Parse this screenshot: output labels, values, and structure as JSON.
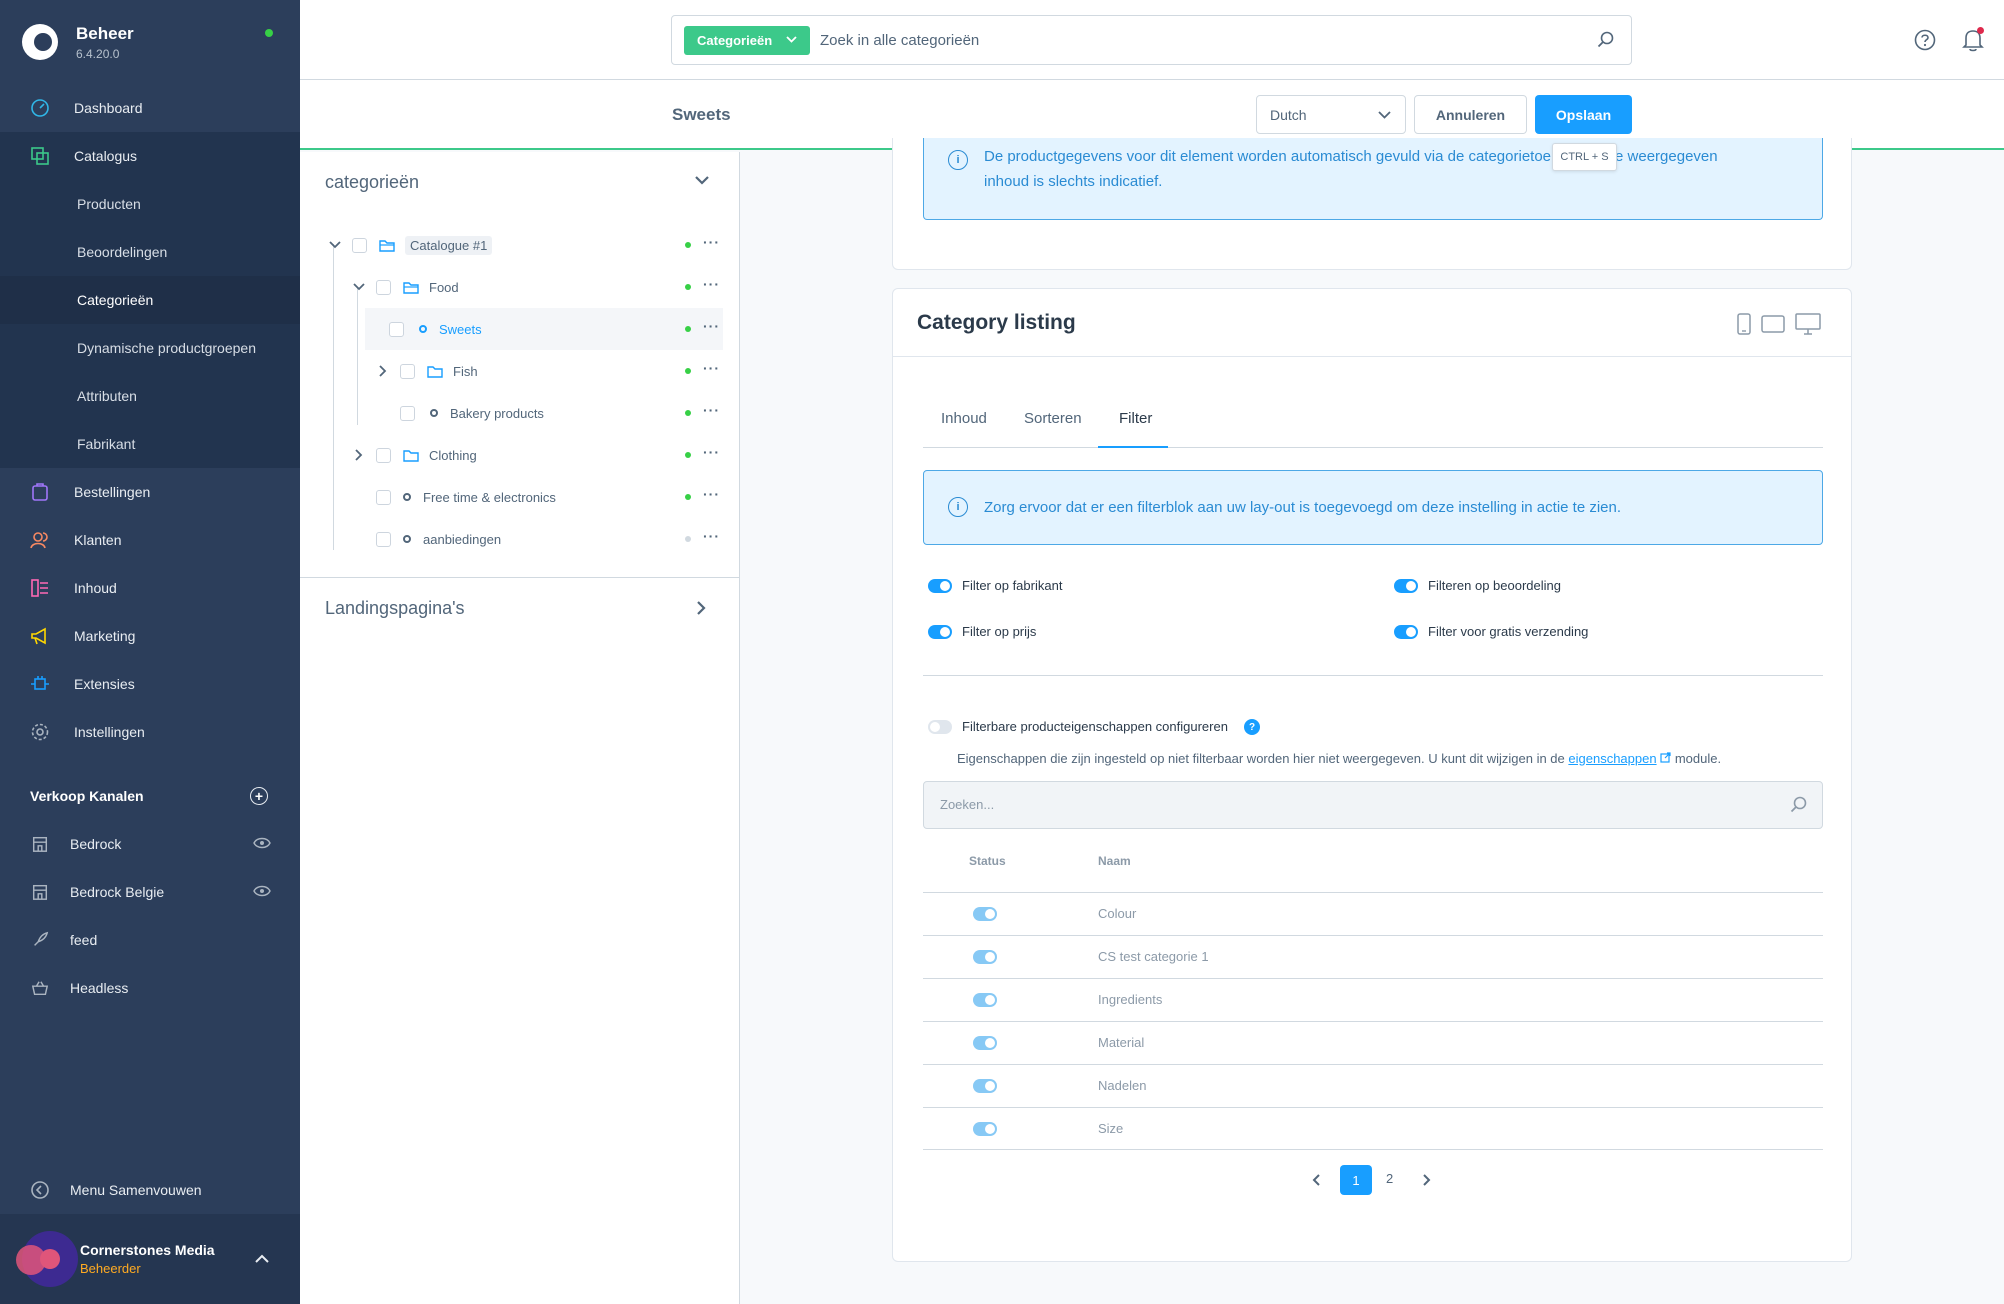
{
  "app": {
    "name": "Beheer",
    "version": "6.4.20.0"
  },
  "sidebar": {
    "main": [
      {
        "label": "Dashboard",
        "icon": "dashboard-icon"
      },
      {
        "label": "Catalogus",
        "icon": "catalog-icon"
      },
      {
        "label": "Bestellingen",
        "icon": "orders-icon"
      },
      {
        "label": "Klanten",
        "icon": "customers-icon"
      },
      {
        "label": "Inhoud",
        "icon": "content-icon"
      },
      {
        "label": "Marketing",
        "icon": "marketing-icon"
      },
      {
        "label": "Extensies",
        "icon": "extensions-icon"
      },
      {
        "label": "Instellingen",
        "icon": "settings-icon"
      }
    ],
    "catalog_sub": [
      "Producten",
      "Beoordelingen",
      "Categorieën",
      "Dynamische productgroepen",
      "Attributen",
      "Fabrikant"
    ],
    "active_sub": "Categorieën",
    "sales_channels_title": "Verkoop Kanalen",
    "channels": [
      "Bedrock",
      "Bedrock Belgie",
      "feed",
      "Headless"
    ],
    "collapse_label": "Menu Samenvouwen",
    "user": {
      "name": "Cornerstones Media",
      "role": "Beheerder"
    }
  },
  "search": {
    "type_label": "Categorieën",
    "placeholder": "Zoek in alle categorieën"
  },
  "smartbar": {
    "title": "Sweets",
    "language": "Dutch",
    "cancel_label": "Annuleren",
    "save_label": "Opslaan",
    "save_tooltip": "CTRL + S"
  },
  "tree": {
    "title": "categorieën",
    "items": [
      "Catalogue #1",
      "Food",
      "Sweets",
      "Fish",
      "Bakery products",
      "Clothing",
      "Free time & electronics",
      "aanbiedingen"
    ],
    "landing_title": "Landingspagina's"
  },
  "info_top": {
    "line1_a": "De productgegevens voor dit element worden automatisch gevuld via de categorietoe",
    "line1_b": "e weergegeven",
    "line2": "inhoud is slechts indicatief."
  },
  "listing": {
    "title": "Category listing",
    "tabs": [
      "Inhoud",
      "Sorteren",
      "Filter"
    ],
    "active_tab": "Filter",
    "info": "Zorg ervoor dat er een filterblok aan uw lay-out is toegevoegd om deze instelling in actie te zien.",
    "filters": [
      {
        "label": "Filter op fabrikant",
        "enabled": true
      },
      {
        "label": "Filteren op beoordeling",
        "enabled": true
      },
      {
        "label": "Filter op prijs",
        "enabled": true
      },
      {
        "label": "Filter voor gratis verzending",
        "enabled": true
      }
    ],
    "configure_label": "Filterbare producteigenschappen configureren",
    "configure_enabled": false,
    "hint_before": "Eigenschappen die zijn ingesteld op niet filterbaar worden hier niet weergegeven. U kunt dit wijzigen in de",
    "hint_link": "eigenschappen",
    "hint_after": "module.",
    "grid_search_placeholder": "Zoeken...",
    "col_status": "Status",
    "col_name": "Naam",
    "rows": [
      "Colour",
      "CS test categorie 1",
      "Ingredients",
      "Material",
      "Nadelen",
      "Size"
    ],
    "pages": [
      "1",
      "2"
    ],
    "current_page": "1"
  },
  "colors": {
    "sidebar_bg": "#2c3e5b",
    "accent_blue": "#189eff",
    "accent_green": "#3cc98a",
    "status_active": "#37d046"
  }
}
